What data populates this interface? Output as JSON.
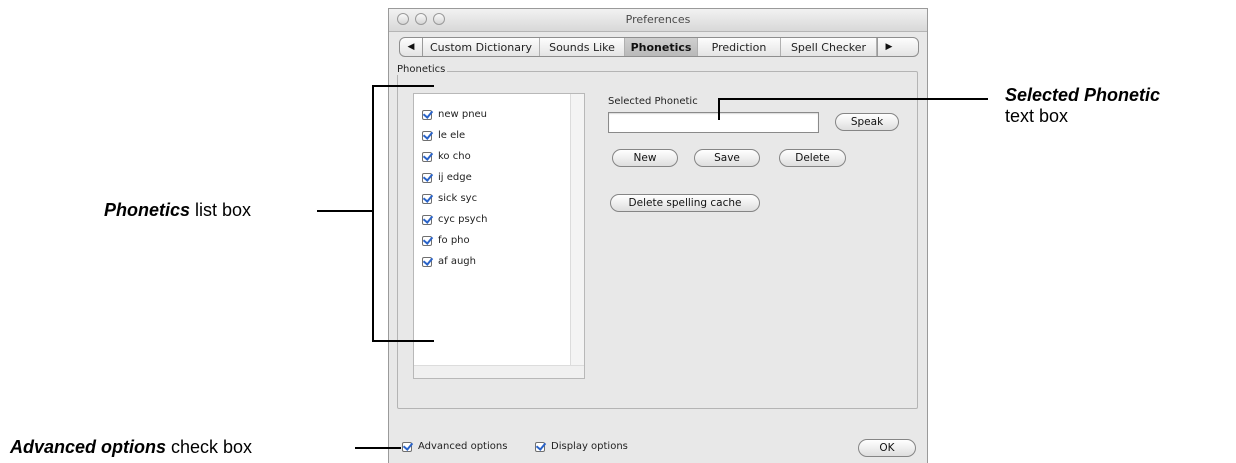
{
  "window": {
    "title": "Preferences"
  },
  "tabs": {
    "left_arrow": "◀",
    "right_arrow": "▶",
    "items": [
      {
        "label": "Custom Dictionary",
        "active": false
      },
      {
        "label": "Sounds Like",
        "active": false
      },
      {
        "label": "Phonetics",
        "active": true
      },
      {
        "label": "Prediction",
        "active": false
      },
      {
        "label": "Spell Checker",
        "active": false
      }
    ]
  },
  "phonetics_group": {
    "label": "Phonetics",
    "list": [
      {
        "label": "new pneu",
        "checked": true
      },
      {
        "label": "le ele",
        "checked": true
      },
      {
        "label": "ko cho",
        "checked": true
      },
      {
        "label": "ij edge",
        "checked": true
      },
      {
        "label": "sick syc",
        "checked": true
      },
      {
        "label": "cyc psych",
        "checked": true
      },
      {
        "label": "fo pho",
        "checked": true
      },
      {
        "label": "af augh",
        "checked": true
      }
    ],
    "selected_phonetic_label": "Selected Phonetic",
    "selected_phonetic_value": "",
    "buttons": {
      "speak": "Speak",
      "new": "New",
      "save": "Save",
      "delete": "Delete",
      "delete_cache": "Delete spelling cache"
    }
  },
  "footer": {
    "advanced_options": {
      "label": "Advanced options",
      "checked": true
    },
    "display_options": {
      "label": "Display options",
      "checked": true
    },
    "ok_button": "OK"
  },
  "annotations": {
    "phonetics_list": {
      "bold": "Phonetics",
      "rest": " list box"
    },
    "selected_phonetic": {
      "bold": "Selected Phonetic",
      "rest": "text box"
    },
    "advanced_options": {
      "bold": "Advanced options",
      "rest": " check box"
    }
  }
}
